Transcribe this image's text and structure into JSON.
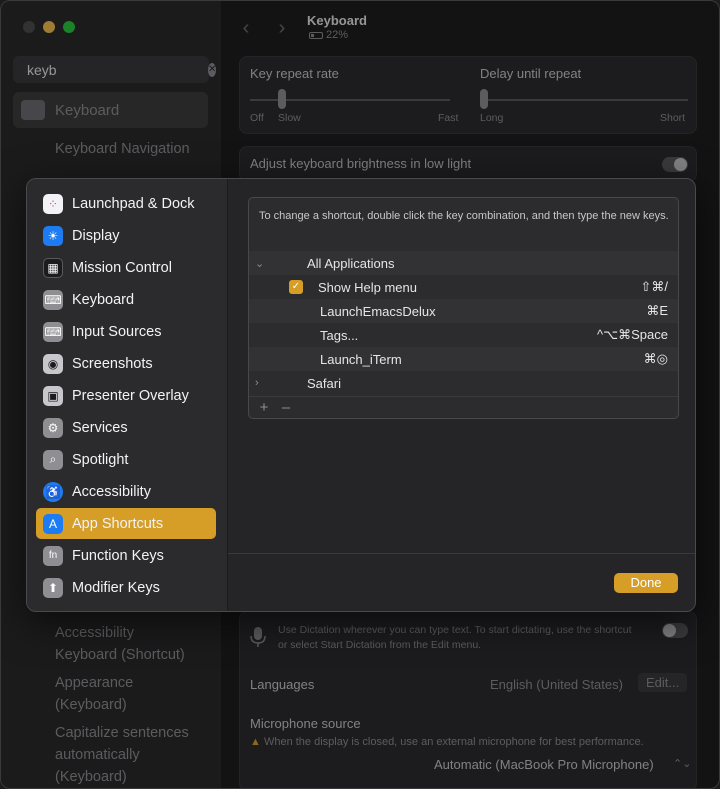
{
  "sidebar": {
    "search_value": "keyb",
    "selected_item": "Keyboard",
    "results_above": [
      "Keyboard Navigation"
    ],
    "results_below": [
      "Accessibility",
      "Keyboard (Shortcut)",
      "Appearance",
      "(Keyboard)",
      "Capitalize sentences",
      "automatically",
      "(Keyboard)"
    ]
  },
  "header": {
    "title": "Keyboard",
    "battery": "22%"
  },
  "key_repeat": {
    "label": "Key repeat rate",
    "left_ticks": [
      "Off",
      "Slow"
    ],
    "right_tick": "Fast",
    "delay_label": "Delay until repeat",
    "delay_left": "Long",
    "delay_right": "Short"
  },
  "brightness": {
    "label": "Adjust keyboard brightness in low light"
  },
  "dictation": {
    "text_line1": "Use Dictation wherever you can type text. To start dictating, use the shortcut",
    "text_line2": "or select Start Dictation from the Edit menu.",
    "languages_label": "Languages",
    "languages_value": "English (United States)",
    "edit_button": "Edit...",
    "mic_label": "Microphone source",
    "mic_warning": "When the display is closed, use an external microphone for best performance.",
    "mic_value": "Automatic (MacBook Pro Microphone)"
  },
  "modal": {
    "categories": [
      {
        "label": "Launchpad & Dock",
        "icon": "launchpad-icon",
        "color": "#f2f2f7"
      },
      {
        "label": "Display",
        "icon": "display-icon",
        "color": "#1e7cf2"
      },
      {
        "label": "Mission Control",
        "icon": "mission-control-icon",
        "color": "#2c2c2e"
      },
      {
        "label": "Keyboard",
        "icon": "keyboard-icon",
        "color": "#8e8e93"
      },
      {
        "label": "Input Sources",
        "icon": "input-sources-icon",
        "color": "#8e8e93"
      },
      {
        "label": "Screenshots",
        "icon": "screenshot-icon",
        "color": "#8e8e93"
      },
      {
        "label": "Presenter Overlay",
        "icon": "presenter-overlay-icon",
        "color": "#8e8e93"
      },
      {
        "label": "Services",
        "icon": "gear-icon",
        "color": "#8e8e93"
      },
      {
        "label": "Spotlight",
        "icon": "spotlight-icon",
        "color": "#8e8e93"
      },
      {
        "label": "Accessibility",
        "icon": "accessibility-icon",
        "color": "#1e7cf2"
      },
      {
        "label": "App Shortcuts",
        "icon": "app-store-icon",
        "color": "#1e7cf2"
      },
      {
        "label": "Function Keys",
        "icon": "fn-icon",
        "color": "#8e8e93"
      },
      {
        "label": "Modifier Keys",
        "icon": "modifier-icon",
        "color": "#8e8e93"
      }
    ],
    "selected_category": "App Shortcuts",
    "hint": "To change a shortcut, double click the key combination, and then type the new keys.",
    "group_all": "All Applications",
    "shortcuts": [
      {
        "name": "Show Help menu",
        "key": "⇧⌘/",
        "checked": true
      },
      {
        "name": "LaunchEmacsDelux",
        "key": "⌘E"
      },
      {
        "name": "Tags...",
        "key": "^⌥⌘Space"
      },
      {
        "name": "Launch_iTerm",
        "key": "⌘◎"
      }
    ],
    "group_safari": "Safari",
    "add": "+",
    "remove": "–",
    "done_button": "Done"
  },
  "colors": {
    "accent": "#d69e27",
    "background": "#1e1e20"
  }
}
